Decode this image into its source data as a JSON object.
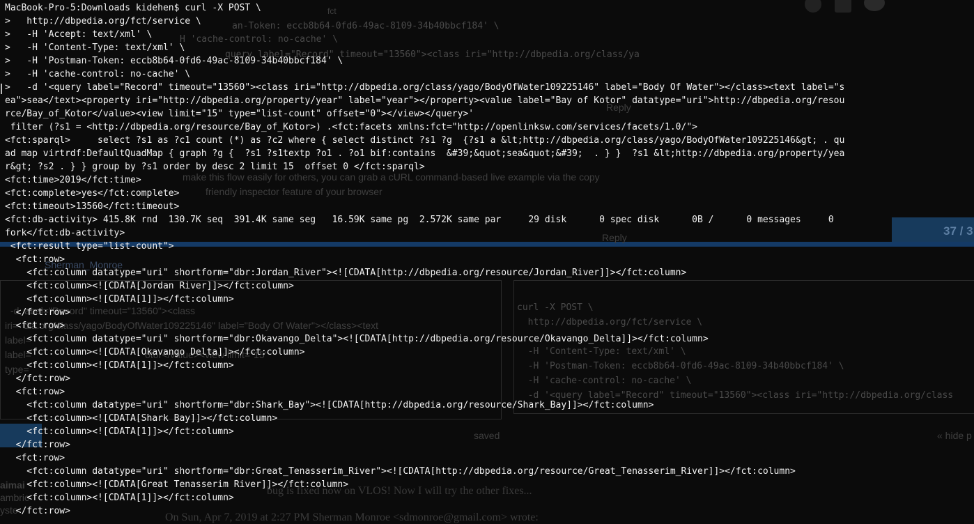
{
  "terminal": {
    "lines": [
      "MacBook-Pro-5:Downloads kidehen$ curl -X POST \\",
      ">   http://dbpedia.org/fct/service \\",
      ">   -H 'Accept: text/xml' \\",
      ">   -H 'Content-Type: text/xml' \\",
      ">   -H 'Postman-Token: eccb8b64-0fd6-49ac-8109-34b40bbcf184' \\",
      ">   -H 'cache-control: no-cache' \\",
      ">   -d '<query label=\"Record\" timeout=\"13560\"><class iri=\"http://dbpedia.org/class/yago/BodyOfWater109225146\" label=\"Body Of Water\"></class><text label=\"s",
      "ea\">sea</text><property iri=\"http://dbpedia.org/property/year\" label=\"year\"></property><value label=\"Bay of Kotor\" datatype=\"uri\">http://dbpedia.org/resou",
      "rce/Bay_of_Kotor</value><view limit=\"15\" type=\"list-count\" offset=\"0\"></view></query>'",
      " filter (?s1 = <http://dbpedia.org/resource/Bay_of_Kotor>) .<fct:facets xmlns:fct=\"http://openlinksw.com/services/facets/1.0/\">",
      "<fct:sparql>     select ?s1 as ?c1 count (*) as ?c2 where { select distinct ?s1 ?g  {?s1 a &lt;http://dbpedia.org/class/yago/BodyOfWater109225146&gt; . qu",
      "ad map virtrdf:DefaultQuadMap { graph ?g {  ?s1 ?s1textp ?o1 . ?o1 bif:contains  &#39;&quot;sea&quot;&#39;  . } }  ?s1 &lt;http://dbpedia.org/property/yea",
      "r&gt; ?s2 . } } group by ?s1 order by desc 2 limit 15  offset 0 </fct:sparql>",
      "<fct:time>2019</fct:time>",
      "<fct:complete>yes</fct:complete>",
      "<fct:timeout>13560</fct:timeout>",
      "<fct:db-activity> 415.8K rnd  130.7K seq  391.4K same seg   16.59K same pg  2.572K same par     29 disk      0 spec disk      0B /      0 messages     0",
      "fork</fct:db-activity>",
      " <fct:result type=\"list-count\">",
      "  <fct:row>",
      "    <fct:column datatype=\"uri\" shortform=\"dbr:Jordan_River\"><![CDATA[http://dbpedia.org/resource/Jordan_River]]></fct:column>",
      "    <fct:column><![CDATA[Jordan River]]></fct:column>",
      "    <fct:column><![CDATA[1]]></fct:column>",
      "  </fct:row>",
      "  <fct:row>",
      "    <fct:column datatype=\"uri\" shortform=\"dbr:Okavango_Delta\"><![CDATA[http://dbpedia.org/resource/Okavango_Delta]]></fct:column>",
      "    <fct:column><![CDATA[Okavango Delta]]></fct:column>",
      "    <fct:column><![CDATA[1]]></fct:column>",
      "  </fct:row>",
      "  <fct:row>",
      "    <fct:column datatype=\"uri\" shortform=\"dbr:Shark_Bay\"><![CDATA[http://dbpedia.org/resource/Shark_Bay]]></fct:column>",
      "    <fct:column><![CDATA[Shark Bay]]></fct:column>",
      "    <fct:column><![CDATA[1]]></fct:column>",
      "  </fct:row>",
      "  <fct:row>",
      "    <fct:column datatype=\"uri\" shortform=\"dbr:Great_Tenasserim_River\"><![CDATA[http://dbpedia.org/resource/Great_Tenasserim_River]]></fct:column>",
      "    <fct:column><![CDATA[Great Tenasserim River]]></fct:column>",
      "    <fct:column><![CDATA[1]]></fct:column>",
      "  </fct:row>"
    ]
  },
  "background": {
    "fct_tag": "fct",
    "postman_token_line": "an-Token: eccb8b64-0fd6-49ac-8109-34b40bbcf184' \\",
    "cache_control_line": "H 'cache-control: no-cache' \\",
    "query_line": "query label=\"Record\" timeout=\"13560\"><class iri=\"http://dbpedia.org/class/ya",
    "reply_top": "Reply",
    "make_flow": "make this flow easily for others, you can grab a cURL command-based live example via the copy",
    "inspector": "friendly inspector feature of your browser",
    "counter": "37 / 3",
    "reply_mid": "Reply",
    "author": "Sherman_Monroe",
    "curl_block": [
      "curl -X POST \\",
      "  http://dbpedia.org/fct/service \\",
      "  -H 'Content-Type: text/xml' \\",
      "  -H 'Postman-Token: eccb8b64-0fd6-49ac-8109-34b40bbcf184' \\",
      "  -H 'cache-control: no-cache' \\",
      "  -d '<query label=\"Record\" timeout=\"13560\"><class iri=\"http://dbpedia.org/class"
    ],
    "left_quote": [
      "-d  abel=\"Record\" timeout=\"13560\"><class",
      "iri=  dia.org/class/yago/BodyOfWater109225146\" label=\"Body Of Water\"></class><text",
      "label=",
      "label=                                          otor</value><view limit=\"15\"",
      "type="
    ],
    "saved": "saved",
    "hide": "« hide p",
    "fixed_line": "bug is fixed now on VLOS! Now I will try the other fixes...",
    "email_line": "On Sun, Apr 7, 2019 at 2:27 PM Sherman Monroe <sdmonroe@gmail.com> wrote:",
    "left_partial": [
      "aimai",
      "ambric",
      "yste"
    ]
  }
}
